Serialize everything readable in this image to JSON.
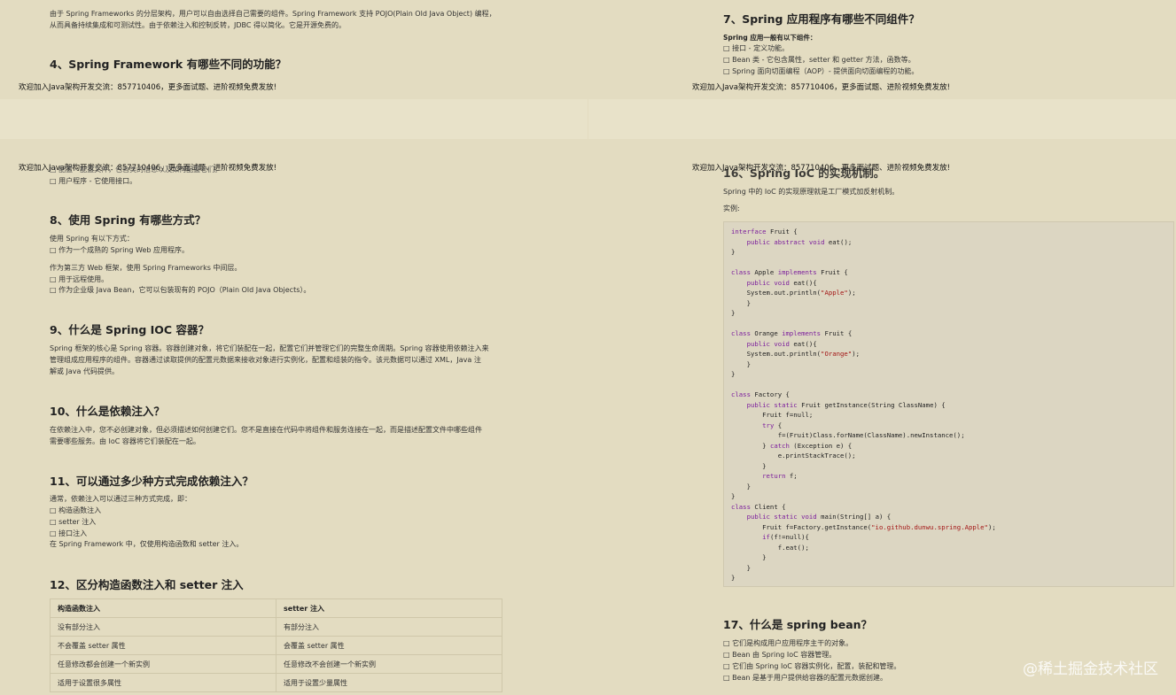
{
  "ad_text": "欢迎加入Java架构开发交流：857710406，更多面试题、进阶视频免费发放!",
  "left": {
    "top_para_1": "由于 Spring Frameworks 的分层架构，用户可以自由选择自己需要的组件。Spring Framework 支持 POJO(Plain Old Java Object) 编程，",
    "top_para_2": "从而具备持续集成和可测试性。由于依赖注入和控制反转，JDBC 得以简化。它是开源免费的。",
    "h4": "4、Spring Framework 有哪些不同的功能？",
    "overlap_line": "□ 配置 - 配置文件，包含类的信息以及如何配置它们。",
    "user_prog": "□ 用户程序 - 它使用接口。",
    "h8": "8、使用 Spring 有哪些方式？",
    "s8": [
      "使用 Spring 有以下方式：",
      "□ 作为一个成熟的 Spring Web 应用程序。",
      "作为第三方 Web 框架，使用 Spring Frameworks 中间层。",
      "□ 用于远程使用。",
      "□ 作为企业级 Java Bean，它可以包装现有的 POJO（Plain Old Java Objects）。"
    ],
    "h9": "9、什么是 Spring IOC 容器？",
    "s9": [
      "Spring 框架的核心是 Spring 容器。容器创建对象，将它们装配在一起，配置它们并管理它们的完整生命周期。Spring 容器使用依赖注入来",
      "管理组成应用程序的组件。容器通过读取提供的配置元数据来接收对象进行实例化，配置和组装的指令。该元数据可以通过 XML，Java 注",
      "解或 Java 代码提供。"
    ],
    "h10": "10、什么是依赖注入？",
    "s10": [
      "在依赖注入中，您不必创建对象，但必须描述如何创建它们。您不是直接在代码中将组件和服务连接在一起，而是描述配置文件中哪些组件",
      "需要哪些服务。由 IoC 容器将它们装配在一起。"
    ],
    "h11": "11、可以通过多少种方式完成依赖注入？",
    "s11": [
      "通常，依赖注入可以通过三种方式完成，即：",
      "□ 构造函数注入",
      "□ setter 注入",
      "□ 接口注入",
      "在 Spring Framework 中，仅使用构造函数和 setter 注入。"
    ],
    "h12": "12、区分构造函数注入和 setter 注入",
    "table": {
      "header": [
        "构造函数注入",
        "setter 注入"
      ],
      "rows": [
        [
          "没有部分注入",
          "有部分注入"
        ],
        [
          "不会覆盖 setter 属性",
          "会覆盖 setter 属性"
        ],
        [
          "任意修改都会创建一个新实例",
          "任意修改不会创建一个新实例"
        ],
        [
          "适用于设置很多属性",
          "适用于设置少量属性"
        ]
      ]
    }
  },
  "right": {
    "h7": "7、Spring 应用程序有哪些不同组件？",
    "s7_title": "Spring 应用一般有以下组件：",
    "s7": [
      "□ 接口 - 定义功能。",
      "□ Bean 类 - 它包含属性，setter 和 getter 方法，函数等。",
      "□ Spring 面向切面编程（AOP）- 提供面向切面编程的功能。"
    ],
    "h16": "16、Spring IoC 的实现机制。",
    "s16_1": "Spring 中的 IoC 的实现原理就是工厂模式加反射机制。",
    "s16_2": "实例:",
    "code_lines": [
      "interface Fruit {",
      "    public abstract void eat();",
      "}",
      "",
      "class Apple implements Fruit {",
      "    public void eat(){",
      "    System.out.println(\"Apple\");",
      "    }",
      "}",
      "",
      "class Orange implements Fruit {",
      "    public void eat(){",
      "    System.out.println(\"Orange\");",
      "    }",
      "}",
      "",
      "class Factory {",
      "    public static Fruit getInstance(String ClassName) {",
      "        Fruit f=null;",
      "        try {",
      "            f=(Fruit)Class.forName(ClassName).newInstance();",
      "        } catch (Exception e) {",
      "            e.printStackTrace();",
      "        }",
      "        return f;",
      "    }",
      "}",
      "class Client {",
      "    public static void main(String[] a) {",
      "        Fruit f=Factory.getInstance(\"io.github.dunwu.spring.Apple\");",
      "        if(f!=null){",
      "            f.eat();",
      "        }",
      "    }",
      "}"
    ],
    "h17": "17、什么是 spring bean？",
    "s17": [
      "□ 它们是构成用户应用程序主干的对象。",
      "□ Bean 由 Spring IoC 容器管理。",
      "□ 它们由 Spring IoC 容器实例化，配置，装配和管理。",
      "□ Bean 是基于用户提供给容器的配置元数据创建。"
    ]
  },
  "watermark": "@稀土掘金技术社区"
}
